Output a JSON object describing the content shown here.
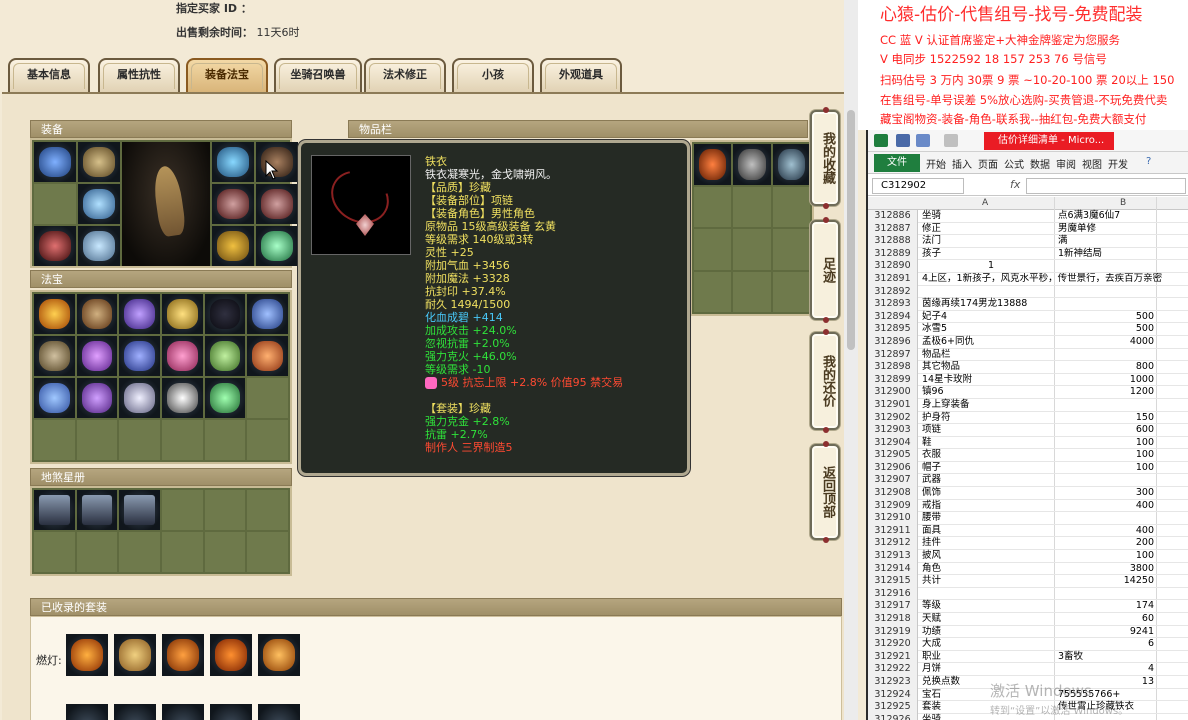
{
  "topinfo": {
    "buyer_label": "指定买家 ID ：",
    "remain_label": "出售剩余时间：",
    "remain_value": "11天6时"
  },
  "tabs": [
    "基本信息",
    "属性抗性",
    "装备法宝",
    "坐骑召唤兽",
    "法术修正",
    "小孩",
    "外观道具"
  ],
  "active_tab": 2,
  "sections": {
    "equipment": "装备",
    "treasure": "法宝",
    "star_book": "地煞星册",
    "inventory": "物品栏",
    "sets": "已收录的套装",
    "sets_row_label": "燃灯:"
  },
  "side_buttons": [
    "我的收藏",
    "足迹",
    "我的还价",
    "返回顶部"
  ],
  "tooltip": {
    "name": "铁衣",
    "desc": "铁衣凝寒光，金戈啸朔风。",
    "quality": "【品质】珍藏",
    "part": "【装备部位】项链",
    "role": "【装备角色】男性角色",
    "origin": "原物品 15级高级装备 玄黄",
    "level_req": "等级需求 140级或3转",
    "spirit": "灵性 +25",
    "hp": "附加气血 +3456",
    "mp": "附加魔法 +3328",
    "seal": "抗封印 +37.4%",
    "durability": "耐久 1494/1500",
    "blood": "化血成碧 +414",
    "atk": "加成攻击 +24.0%",
    "ignore": "忽视抗雷 +2.0%",
    "fire": "强力克火 +46.0%",
    "lvl": "等级需求 -10",
    "gem": "5级 抗忘上限 +2.8% 价值95 禁交易",
    "set_title": "【套装】珍藏",
    "set_gold": "强力克金 +2.8%",
    "set_thunder": "抗雷 +2.7%",
    "maker": "制作人 三界制造5"
  },
  "ad": {
    "line1": "心猿-估价-代售组号-找号-免费配装",
    "line2": "CC 蓝 V 认证首席鉴定+大神金牌鉴定为您服务",
    "line3": "V 电同步 1522592 18 157 253 76 号信号",
    "line4": "扫码估号 3 万内 30票 9 票 ~10-20-100 票 20以上 150",
    "line5": "在售组号-单号误差 5%放心选购-买贵管退-不玩免费代卖",
    "line6": "藏宝阁物资-装备-角色-联系我--抽红包-免费大额支付"
  },
  "excel": {
    "title": "估价详细清单 - Micro...",
    "ribbon": [
      "文件",
      "开始",
      "插入",
      "页面",
      "公式",
      "数据",
      "审阅",
      "视图",
      "开发"
    ],
    "namebox": "C312902",
    "fx": "fx",
    "col_a": "A",
    "col_b": "B",
    "rows": [
      {
        "n": "312886",
        "a": "坐骑",
        "b": "点6满3魔6仙7"
      },
      {
        "n": "312887",
        "a": "修正",
        "b": "男魔单修"
      },
      {
        "n": "312888",
        "a": "法门",
        "b": "满"
      },
      {
        "n": "312889",
        "a": "孩子",
        "b": "1新神结局"
      },
      {
        "n": "312890",
        "a": "",
        "b": "",
        "mid": "1"
      },
      {
        "n": "312891",
        "wide": "4上区，1新孩子，风克水平秒，传世景行，去疾百万亲密"
      },
      {
        "n": "312892",
        "a": "",
        "b": ""
      },
      {
        "n": "312893",
        "a": "茵缘再续174男龙13888",
        "b": ""
      },
      {
        "n": "312894",
        "a": "妃子4",
        "b": "500",
        "num": true
      },
      {
        "n": "312895",
        "a": "冰雪5",
        "b": "500",
        "num": true
      },
      {
        "n": "312896",
        "a": "孟极6+同仇",
        "b": "4000",
        "num": true
      },
      {
        "n": "312897",
        "a": "物品栏",
        "b": ""
      },
      {
        "n": "312898",
        "a": "其它物品",
        "b": "800",
        "num": true
      },
      {
        "n": "312899",
        "a": "14星卡玫附",
        "b": "1000",
        "num": true
      },
      {
        "n": "312900",
        "a": "镇96",
        "b": "1200",
        "num": true
      },
      {
        "n": "312901",
        "a": "身上穿装备",
        "b": ""
      },
      {
        "n": "312902",
        "a": "护身符",
        "b": "150",
        "num": true
      },
      {
        "n": "312903",
        "a": "项链",
        "b": "600",
        "num": true
      },
      {
        "n": "312904",
        "a": "鞋",
        "b": "100",
        "num": true
      },
      {
        "n": "312905",
        "a": "衣服",
        "b": "100",
        "num": true
      },
      {
        "n": "312906",
        "a": "帽子",
        "b": "100",
        "num": true
      },
      {
        "n": "312907",
        "a": "武器",
        "b": ""
      },
      {
        "n": "312908",
        "a": "佩饰",
        "b": "300",
        "num": true
      },
      {
        "n": "312909",
        "a": "戒指",
        "b": "400",
        "num": true
      },
      {
        "n": "312910",
        "a": "腰带",
        "b": ""
      },
      {
        "n": "312911",
        "a": "面具",
        "b": "400",
        "num": true
      },
      {
        "n": "312912",
        "a": "挂件",
        "b": "200",
        "num": true
      },
      {
        "n": "312913",
        "a": "披风",
        "b": "100",
        "num": true
      },
      {
        "n": "312914",
        "a": "角色",
        "b": "3800",
        "num": true
      },
      {
        "n": "312915",
        "a": "共计",
        "b": "14250",
        "num": true
      },
      {
        "n": "312916",
        "a": "",
        "b": ""
      },
      {
        "n": "312917",
        "a": "等级",
        "b": "174",
        "num": true
      },
      {
        "n": "312918",
        "a": "天赋",
        "b": "60",
        "num": true
      },
      {
        "n": "312919",
        "a": "功绩",
        "b": "9241",
        "num": true
      },
      {
        "n": "312920",
        "a": "大成",
        "b": "6",
        "num": true
      },
      {
        "n": "312921",
        "a": "职业",
        "b": "3畜牧"
      },
      {
        "n": "312922",
        "a": "月饼",
        "b": "4",
        "num": true
      },
      {
        "n": "312923",
        "a": "兑换点数",
        "b": "13",
        "num": true
      },
      {
        "n": "312924",
        "a": "宝石",
        "b": "755555766+"
      },
      {
        "n": "312925",
        "a": "套装",
        "b": "传世霄止珍藏铁衣"
      },
      {
        "n": "312926",
        "a": "坐骑",
        "b": ""
      }
    ]
  },
  "watermark": {
    "line1": "激活 Windows",
    "line2": "转到“设置”以激活 Windows。"
  }
}
